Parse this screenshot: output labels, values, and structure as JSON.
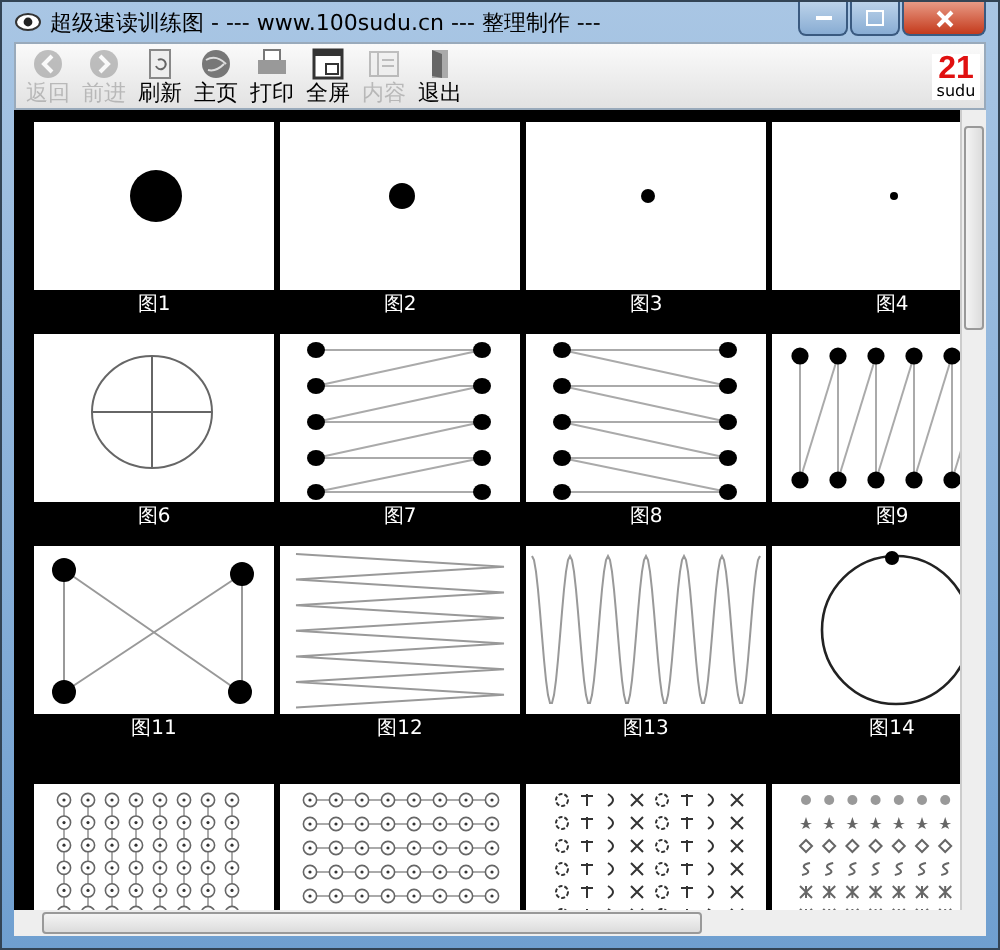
{
  "window": {
    "title": "超级速读训练图 - --- www.100sudu.cn --- 整理制作 ---"
  },
  "toolbar": [
    {
      "label": "返回",
      "disabled": true
    },
    {
      "label": "前进",
      "disabled": true
    },
    {
      "label": "刷新",
      "disabled": false
    },
    {
      "label": "主页",
      "disabled": false
    },
    {
      "label": "打印",
      "disabled": false
    },
    {
      "label": "全屏",
      "disabled": false
    },
    {
      "label": "内容",
      "disabled": true
    },
    {
      "label": "退出",
      "disabled": false
    }
  ],
  "logo": {
    "number": "21",
    "word": "sudu"
  },
  "cards": [
    {
      "kind": "large-dot",
      "caption": "图1"
    },
    {
      "kind": "medium-dot",
      "caption": "图2"
    },
    {
      "kind": "small-dot",
      "caption": "图3"
    },
    {
      "kind": "tiny-dot",
      "caption": "图4"
    },
    {
      "kind": "circle-cross",
      "caption": "图6"
    },
    {
      "kind": "zigzag-up",
      "caption": "图7"
    },
    {
      "kind": "zigzag-down",
      "caption": "图8"
    },
    {
      "kind": "column-zigzag",
      "caption": "图9"
    },
    {
      "kind": "x-shape",
      "caption": "图11"
    },
    {
      "kind": "horizontal-wave",
      "caption": "图12"
    },
    {
      "kind": "vertical-wave",
      "caption": "图13"
    },
    {
      "kind": "orbit",
      "caption": "图14"
    },
    {
      "kind": "ring-columns"
    },
    {
      "kind": "ring-rows"
    },
    {
      "kind": "mixed-symbols"
    },
    {
      "kind": "symbol-rows"
    }
  ]
}
